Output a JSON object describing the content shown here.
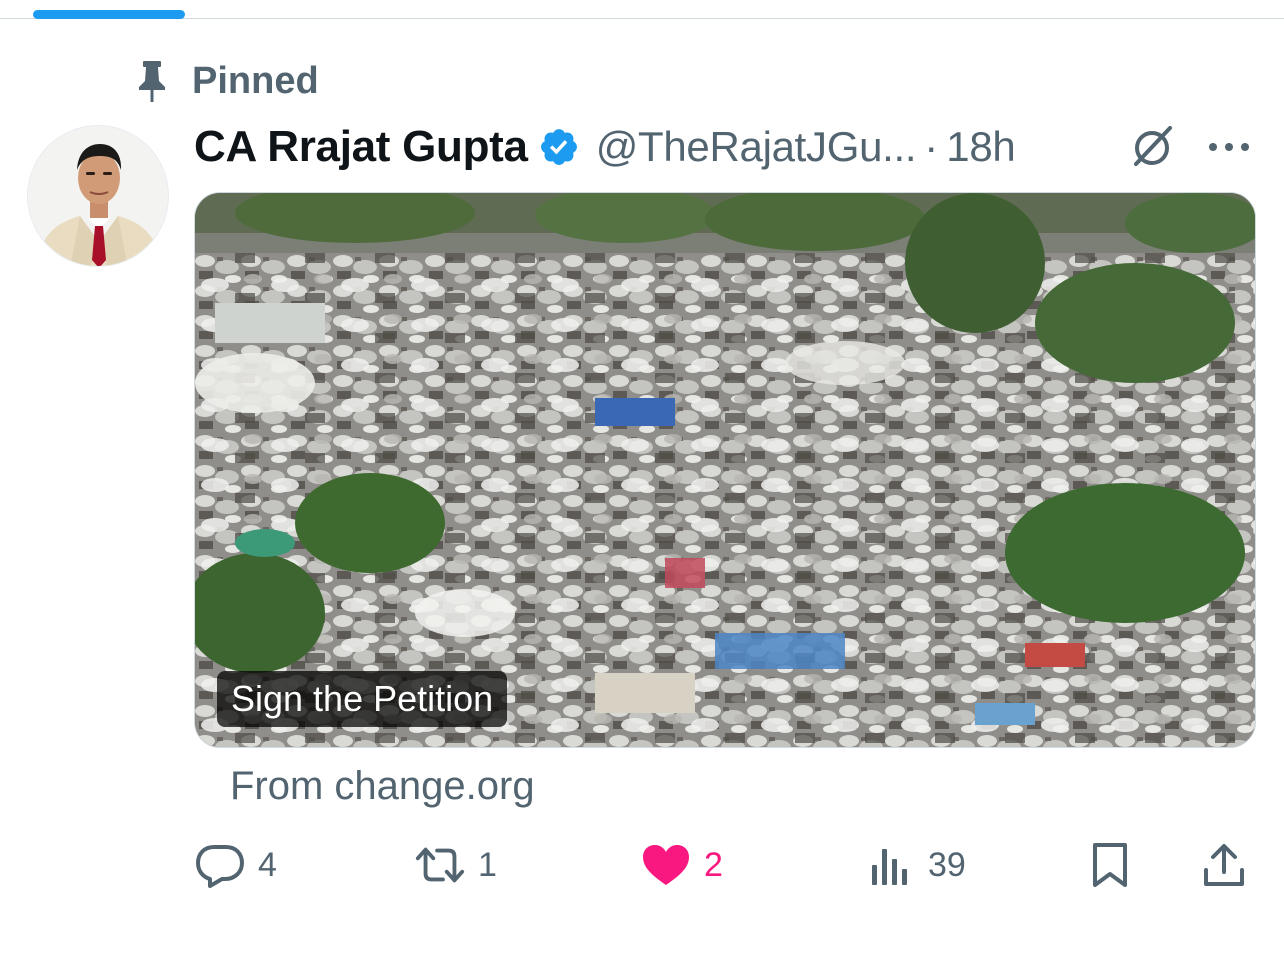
{
  "pinned": {
    "label": "Pinned"
  },
  "author": {
    "name": "CA Rrajat Gupta",
    "handle": "@TheRajatJGu...",
    "separator": "·",
    "time": "18h",
    "verified": true
  },
  "card": {
    "title": "Sign the Petition",
    "source": "From change.org"
  },
  "actions": {
    "replies": "4",
    "reposts": "1",
    "likes": "2",
    "views": "39",
    "liked": true
  },
  "icons": {
    "pin": "pin-icon",
    "verified": "verified-badge-icon",
    "grok": "grok-icon",
    "more": "more-icon",
    "reply": "reply-icon",
    "repost": "repost-icon",
    "like": "heart-icon",
    "views": "views-icon",
    "bookmark": "bookmark-icon",
    "share": "share-icon"
  },
  "colors": {
    "accent": "#1d9bf0",
    "like": "#f91880",
    "secondary_text": "#536471",
    "primary_text": "#0f1419"
  }
}
